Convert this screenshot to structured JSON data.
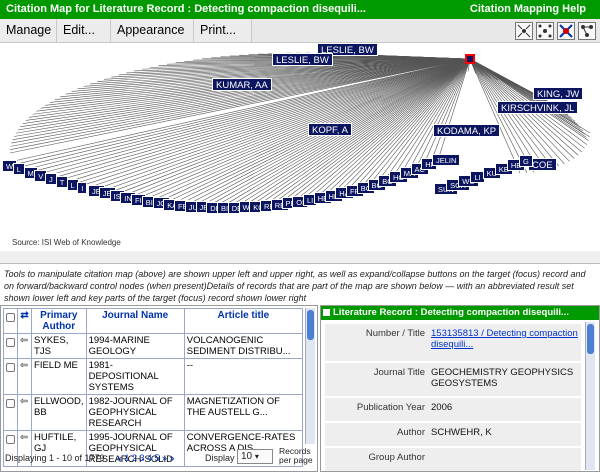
{
  "title_bar": {
    "title": "Citation Map for  Literature Record : Detecting compaction disequili...",
    "help": "Citation Mapping Help"
  },
  "menu": [
    "Manage",
    "Edit...",
    "Appearance",
    "Print..."
  ],
  "toolbar_icons": [
    "expand-icon",
    "collapse-icon",
    "network-icon",
    "reset-icon"
  ],
  "map": {
    "labeled_nodes": [
      "LESLIE, BW",
      "LESLIE, BW",
      "KUMAR, AA",
      "KING, JW",
      "KIRSCHVINK, JL",
      "KOPF, A",
      "KODAMA, KP",
      "COE"
    ],
    "ring_nodes_left": [
      "W",
      "L",
      "M",
      "V",
      "J",
      "T",
      "L",
      "I",
      "JE",
      "JE",
      "IS",
      "IN",
      "FI",
      "BI",
      "JO",
      "KA",
      "FE",
      "JU",
      "JE",
      "DE",
      "BI",
      "DE",
      "W",
      "KO",
      "RE",
      "RE",
      "PR",
      "OI",
      "LI",
      "HE",
      "HE",
      "HA",
      "FR",
      "BC",
      "BC",
      "BC",
      "HO",
      "MA",
      "AC",
      "HI",
      "JELIN"
    ],
    "ring_nodes_right": [
      "SUN",
      "SCH",
      "WU",
      "LI",
      "KU",
      "KE",
      "HE",
      "G"
    ],
    "source": "Source: ISI Web of Knowledge"
  },
  "info_text": "Tools to manipulate citation map (above) are shown upper left and upper right, as well as expand/collapse buttons on the target (focus) record and on forward/backward control nodes (when present)Details of records that are part of the map are shown below — with an abbreviated result set shown lower left and key parts of the target (focus) record shown lower right",
  "results": {
    "headers": [
      "Primary Author",
      "Journal Name",
      "Article title"
    ],
    "rows": [
      {
        "author": "SYKES, TJS",
        "journal": "1994-MARINE GEOLOGY",
        "article": "VOLCANOGENIC SEDIMENT DISTRIBU..."
      },
      {
        "author": "FIELD ME",
        "journal": "1981-DEPOSITIONAL SYSTEMS",
        "article": "--"
      },
      {
        "author": "ELLWOOD, BB",
        "journal": "1982-JOURNAL OF GEOPHYSICAL RESEARCH",
        "article": "MAGNETIZATION OF THE AUSTELL G..."
      },
      {
        "author": "HUFTILE, GJ",
        "journal": "1995-JOURNAL OF GEOPHYSICAL RESEARCH-SOLID",
        "article": "CONVERGENCE-RATES ACROSS A DIS..."
      }
    ],
    "displaying": "Displaying 1 - 10 of 1779",
    "pages": "« 1 2 3 4 5 » »",
    "display_label": "Display",
    "display_value": "10",
    "records_per_page": "Records per page"
  },
  "detail": {
    "header": "Literature Record : Detecting compaction disequili...",
    "fields": [
      {
        "label": "Number / Title",
        "value": "153135813 / Detecting compaction disequili...",
        "link": true
      },
      {
        "label": "Journal Title",
        "value": "GEOCHEMISTRY GEOPHYSICS GEOSYSTEMS",
        "link": false
      },
      {
        "label": "Publication Year",
        "value": "2006",
        "link": false
      },
      {
        "label": "Author",
        "value": "SCHWEHR, K",
        "link": false
      },
      {
        "label": "Group Author",
        "value": "",
        "link": false
      }
    ]
  },
  "colors": {
    "title_green": "#009900",
    "node_navy": "#0b1560",
    "link_blue": "#0033cc",
    "target_red": "#ff0000"
  }
}
